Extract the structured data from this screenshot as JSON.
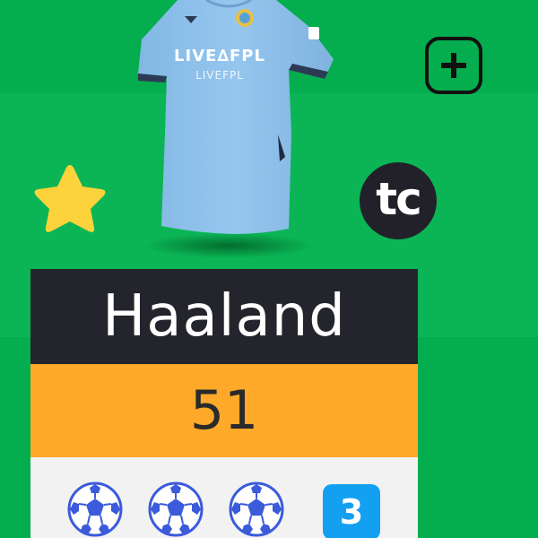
{
  "player": {
    "name": "Haaland",
    "points": "51",
    "captain_badge": "tc",
    "goals_icon": "football-icon",
    "goals_count": "3",
    "shirt_sponsor": "LIVE∆FPL",
    "shirt_sponsor_sub": "LIVEFPL"
  },
  "actions": {
    "add_icon": "plus-square-icon"
  },
  "colors": {
    "pitch": "#0bb555",
    "pitch_stripe": "#04ad4e",
    "name_bg": "#24252c",
    "points_bg": "#ffa92b",
    "stats_bg": "#f2f2f2",
    "goals_badge": "#14a0f0",
    "shirt": "#8ec1ea",
    "star": "#fcd33a"
  }
}
